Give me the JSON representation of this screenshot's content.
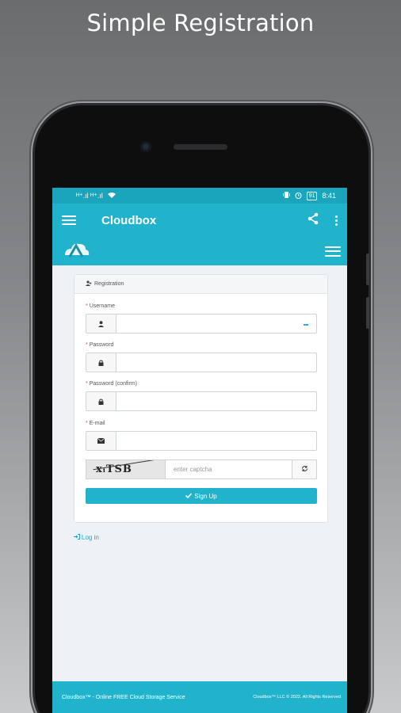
{
  "promo": {
    "title": "Simple Registration"
  },
  "statusbar": {
    "signal": "ᴴ⁺.ıl ᴴ⁺.ıl",
    "battery": "91",
    "time": "8:41"
  },
  "appbar": {
    "title": "Cloudbox"
  },
  "card": {
    "heading": "Registration",
    "username_label": "Username",
    "password_label": "Password",
    "password_confirm_label": "Password (confirm)",
    "email_label": "E-mail",
    "required_mark": "*",
    "captcha_text": "xᵢTSB",
    "captcha_placeholder": "enter captcha",
    "signup_label": "Sign Up"
  },
  "login_label": "Log in",
  "footer": {
    "left": "Cloudbox™ - Online FREE Cloud Storage Service",
    "right": "Cloudbox™ LLC © 2022. All Rights Reserved"
  },
  "colors": {
    "accent": "#22b3cc",
    "statusbar": "#1aa5bd",
    "background": "#eef1f5"
  }
}
